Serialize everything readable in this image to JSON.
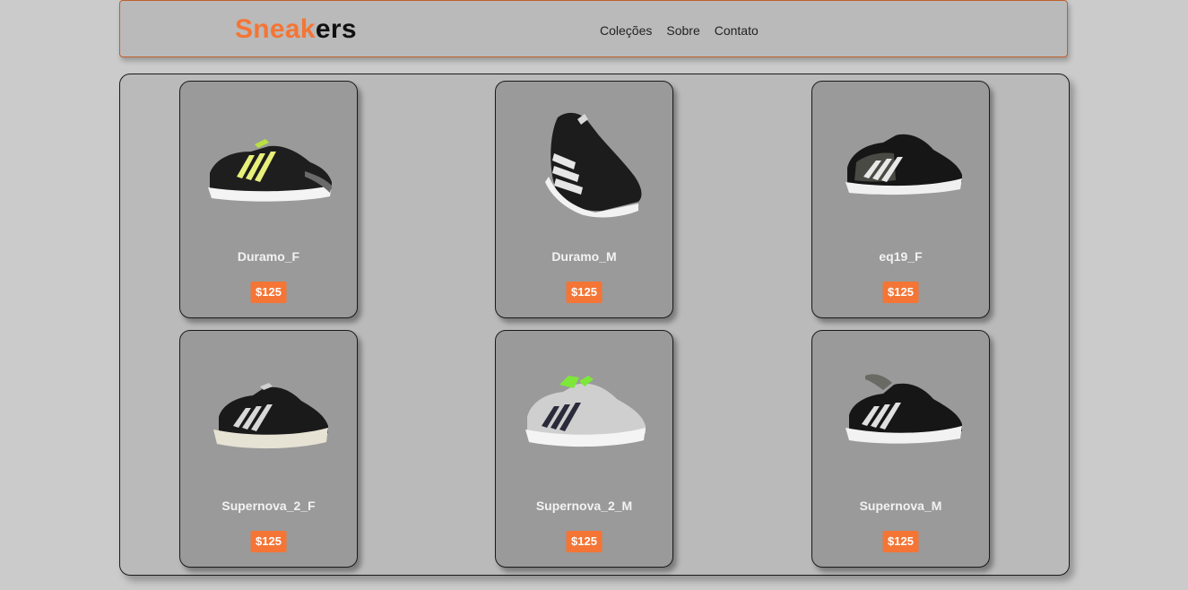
{
  "header": {
    "logo_accent": "Sneak",
    "logo_rest": "ers",
    "nav": [
      "Coleções",
      "Sobre",
      "Contato"
    ]
  },
  "colors": {
    "accent": "#f47535",
    "page_bg": "#cbcbcb",
    "panel_bg": "#bababa",
    "card_bg": "#9a9a9a"
  },
  "products": [
    {
      "name": "Duramo_F",
      "price": "$125",
      "image": "sneaker-black-yellow-stripes"
    },
    {
      "name": "Duramo_M",
      "price": "$125",
      "image": "sneaker-black-white-stripes-angled"
    },
    {
      "name": "eq19_F",
      "price": "$125",
      "image": "sneaker-black-grey-panel"
    },
    {
      "name": "Supernova_2_F",
      "price": "$125",
      "image": "sneaker-black-cream-sole"
    },
    {
      "name": "Supernova_2_M",
      "price": "$125",
      "image": "sneaker-grey-green-collar"
    },
    {
      "name": "Supernova_M",
      "price": "$125",
      "image": "sneaker-black-white-sole"
    }
  ]
}
